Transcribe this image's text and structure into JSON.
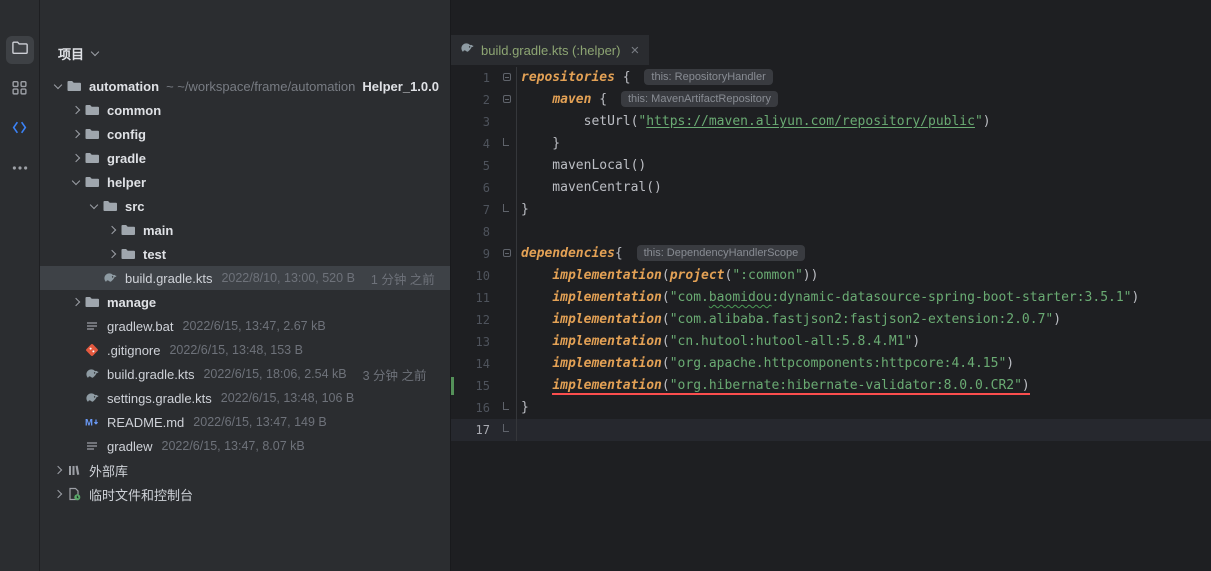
{
  "colors": {
    "editor_bg": "#1E1F22",
    "panel_bg": "#2B2D30",
    "selection_bg": "#3E4247",
    "caret_line_bg": "#26282E",
    "string_green": "#6AAB73",
    "function_orange": "#E3A155",
    "error_red": "#FB4E4E",
    "vcs_added_green": "#549159",
    "tab_file_green": "#8DA573",
    "accent_blue": "#3B82F6"
  },
  "activity_bar": {
    "items": [
      {
        "name": "project"
      },
      {
        "name": "structure"
      },
      {
        "name": "plugins"
      },
      {
        "name": "more"
      }
    ]
  },
  "project_panel": {
    "title": "项目",
    "tree": [
      {
        "level": 0,
        "chevron": "down",
        "icon": "folder",
        "name": "automation",
        "bold": true,
        "dim": "~ ~/workspace/frame/automation",
        "suffix": "Helper_1.0.0"
      },
      {
        "level": 1,
        "chevron": "right",
        "icon": "folder",
        "name": "common",
        "bold": true
      },
      {
        "level": 1,
        "chevron": "right",
        "icon": "folder",
        "name": "config",
        "bold": true
      },
      {
        "level": 1,
        "chevron": "right",
        "icon": "folder",
        "name": "gradle",
        "bold": true
      },
      {
        "level": 1,
        "chevron": "down",
        "icon": "folder",
        "name": "helper",
        "bold": true
      },
      {
        "level": 2,
        "chevron": "down",
        "icon": "folder",
        "name": "src",
        "bold": true
      },
      {
        "level": 3,
        "chevron": "right",
        "icon": "folder",
        "name": "main",
        "bold": true
      },
      {
        "level": 3,
        "chevron": "right",
        "icon": "folder",
        "name": "test",
        "bold": true
      },
      {
        "level": 2,
        "chevron": null,
        "icon": "gradle",
        "name": "build.gradle.kts",
        "meta": "2022/8/10, 13:00, 520 B",
        "meta2": "1 分钟 之前",
        "selected": true
      },
      {
        "level": 1,
        "chevron": "right",
        "icon": "folder",
        "name": "manage",
        "bold": true
      },
      {
        "level": 1,
        "chevron": null,
        "icon": "file",
        "name": "gradlew.bat",
        "meta": "2022/6/15, 13:47, 2.67 kB"
      },
      {
        "level": 1,
        "chevron": null,
        "icon": "git",
        "name": ".gitignore",
        "meta": "2022/6/15, 13:48, 153 B"
      },
      {
        "level": 1,
        "chevron": null,
        "icon": "gradle",
        "name": "build.gradle.kts",
        "meta": "2022/6/15, 18:06, 2.54 kB",
        "meta2": "3 分钟 之前"
      },
      {
        "level": 1,
        "chevron": null,
        "icon": "gradle",
        "name": "settings.gradle.kts",
        "meta": "2022/6/15, 13:48, 106 B"
      },
      {
        "level": 1,
        "chevron": null,
        "icon": "md",
        "name": "README.md",
        "meta": "2022/6/15, 13:47, 149 B"
      },
      {
        "level": 1,
        "chevron": null,
        "icon": "file",
        "name": "gradlew",
        "meta": "2022/6/15, 13:47, 8.07 kB"
      },
      {
        "level": 0,
        "chevron": "right",
        "icon": "lib",
        "name": "外部库"
      },
      {
        "level": 0,
        "chevron": "right",
        "icon": "scratch",
        "name": "临时文件和控制台"
      }
    ]
  },
  "editor": {
    "tab": {
      "label": "build.gradle.kts (:helper)",
      "close_glyph": "×"
    },
    "lines": [
      {
        "n": 1,
        "fold": "start",
        "inlay": "this: RepositoryHandler",
        "segs": [
          {
            "c": "fn",
            "t": "repositories"
          },
          {
            "c": "pl",
            "t": " { "
          }
        ]
      },
      {
        "n": 2,
        "fold": "start",
        "inlay": "this: MavenArtifactRepository",
        "segs": [
          {
            "c": "pl",
            "t": "    "
          },
          {
            "c": "fn",
            "t": "maven"
          },
          {
            "c": "pl",
            "t": " { "
          }
        ]
      },
      {
        "n": 3,
        "segs": [
          {
            "c": "pl",
            "t": "        setUrl("
          },
          {
            "c": "str",
            "t": "\""
          },
          {
            "c": "link",
            "t": "https://maven.aliyun.com/repository/public"
          },
          {
            "c": "str",
            "t": "\""
          },
          {
            "c": "pl",
            "t": ")"
          }
        ]
      },
      {
        "n": 4,
        "fold": "end",
        "segs": [
          {
            "c": "pl",
            "t": "    }"
          }
        ]
      },
      {
        "n": 5,
        "segs": [
          {
            "c": "pl",
            "t": "    mavenLocal()"
          }
        ]
      },
      {
        "n": 6,
        "segs": [
          {
            "c": "pl",
            "t": "    mavenCentral()"
          }
        ]
      },
      {
        "n": 7,
        "fold": "end",
        "segs": [
          {
            "c": "pl",
            "t": "}"
          }
        ]
      },
      {
        "n": 8,
        "segs": []
      },
      {
        "n": 9,
        "fold": "start",
        "inlay": "this: DependencyHandlerScope",
        "segs": [
          {
            "c": "fn",
            "t": "dependencies"
          },
          {
            "c": "pl",
            "t": "{ "
          }
        ]
      },
      {
        "n": 10,
        "segs": [
          {
            "c": "pl",
            "t": "    "
          },
          {
            "c": "fn",
            "t": "implementation"
          },
          {
            "c": "pl",
            "t": "("
          },
          {
            "c": "fn",
            "t": "project"
          },
          {
            "c": "pl",
            "t": "("
          },
          {
            "c": "str",
            "t": "\":common\""
          },
          {
            "c": "pl",
            "t": "))"
          }
        ]
      },
      {
        "n": 11,
        "segs": [
          {
            "c": "pl",
            "t": "    "
          },
          {
            "c": "fn",
            "t": "implementation"
          },
          {
            "c": "pl",
            "t": "("
          },
          {
            "c": "str",
            "t": "\"com."
          },
          {
            "c": "typo",
            "t": "baomidou"
          },
          {
            "c": "str",
            "t": ":dynamic-datasource-spring-boot-starter:3.5.1\""
          },
          {
            "c": "pl",
            "t": ")"
          }
        ]
      },
      {
        "n": 12,
        "segs": [
          {
            "c": "pl",
            "t": "    "
          },
          {
            "c": "fn",
            "t": "implementation"
          },
          {
            "c": "pl",
            "t": "("
          },
          {
            "c": "str",
            "t": "\"com.alibaba.fastjson2:fastjson2-extension:2.0.7\""
          },
          {
            "c": "pl",
            "t": ")"
          }
        ]
      },
      {
        "n": 13,
        "segs": [
          {
            "c": "pl",
            "t": "    "
          },
          {
            "c": "fn",
            "t": "implementation"
          },
          {
            "c": "pl",
            "t": "("
          },
          {
            "c": "str",
            "t": "\"cn.hutool:hutool-all:5.8.4.M1\""
          },
          {
            "c": "pl",
            "t": ")"
          }
        ]
      },
      {
        "n": 14,
        "segs": [
          {
            "c": "pl",
            "t": "    "
          },
          {
            "c": "fn",
            "t": "implementation"
          },
          {
            "c": "pl",
            "t": "("
          },
          {
            "c": "str",
            "t": "\"org.apache.httpcomponents:httpcore:4.4.15\""
          },
          {
            "c": "pl",
            "t": ")"
          }
        ]
      },
      {
        "n": 15,
        "vcs": true,
        "segs": [
          {
            "c": "pl",
            "t": "    "
          },
          {
            "c": "fn",
            "t": "implementation",
            "u": true
          },
          {
            "c": "pl",
            "t": "(",
            "u": true
          },
          {
            "c": "str",
            "t": "\"org.hibernate:hibernate-validator:8.0.0.CR2\"",
            "u": true
          },
          {
            "c": "pl",
            "t": ")",
            "u": true
          }
        ]
      },
      {
        "n": 16,
        "fold": "end",
        "segs": [
          {
            "c": "pl",
            "t": "}"
          }
        ]
      },
      {
        "n": 17,
        "current": true,
        "fold": "end",
        "segs": []
      }
    ]
  }
}
